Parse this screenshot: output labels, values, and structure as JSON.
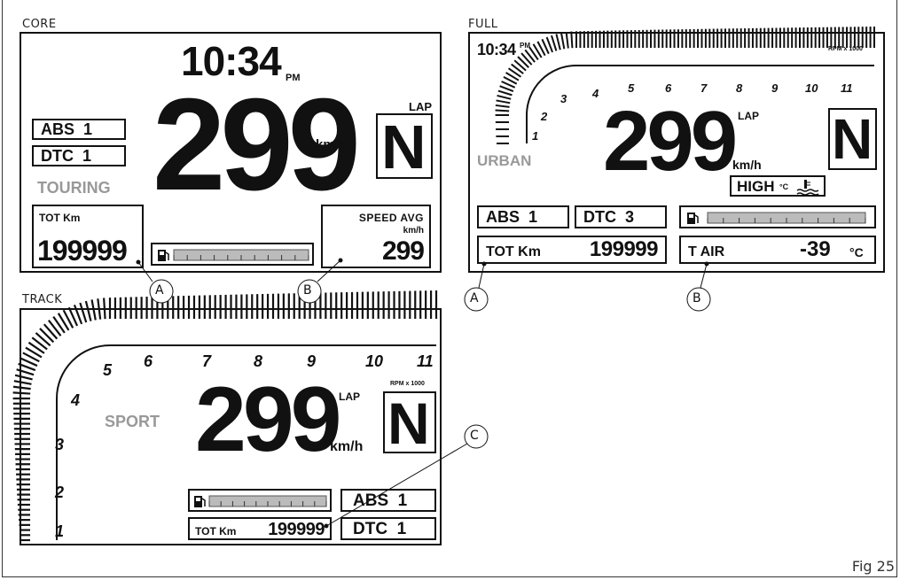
{
  "figure_label": "Fig 25",
  "core": {
    "label": "CORE",
    "time": "10:34",
    "ampm": "PM",
    "speed": "299",
    "speed_unit": "km/h",
    "lap": "LAP",
    "gear": "N",
    "abs": "ABS  1",
    "dtc": "DTC  1",
    "mode": "TOURING",
    "odo_label": "TOT Km",
    "odo_value": "199999",
    "avg_label": "SPEED AVG",
    "avg_unit": "km/h",
    "avg_value": "299",
    "callout_a": "A",
    "callout_b": "B"
  },
  "full": {
    "label": "FULL",
    "time": "10:34",
    "ampm": "PM",
    "rpm_label": "RPM x 1000",
    "rpm_ticks": [
      "1",
      "2",
      "3",
      "4",
      "5",
      "6",
      "7",
      "8",
      "9",
      "10",
      "11"
    ],
    "speed": "299",
    "speed_unit": "km/h",
    "lap": "LAP",
    "gear": "N",
    "mode": "URBAN",
    "temp_status": "HIGH",
    "temp_unit": "°C",
    "abs": "ABS  1",
    "dtc": "DTC  3",
    "odo_label": "TOT Km",
    "odo_value": "199999",
    "air_label": "T AIR",
    "air_value": "-39",
    "air_unit": "°C",
    "callout_a": "A",
    "callout_b": "B"
  },
  "track": {
    "label": "TRACK",
    "rpm_label": "RPM x 1000",
    "rpm_ticks": [
      "1",
      "2",
      "3",
      "4",
      "5",
      "6",
      "7",
      "8",
      "9",
      "10",
      "11"
    ],
    "speed": "299",
    "speed_unit": "km/h",
    "lap": "LAP",
    "gear": "N",
    "mode": "SPORT",
    "abs": "ABS  1",
    "dtc": "DTC  1",
    "odo_label": "TOT Km",
    "odo_value": "199999",
    "callout_c": "C"
  }
}
